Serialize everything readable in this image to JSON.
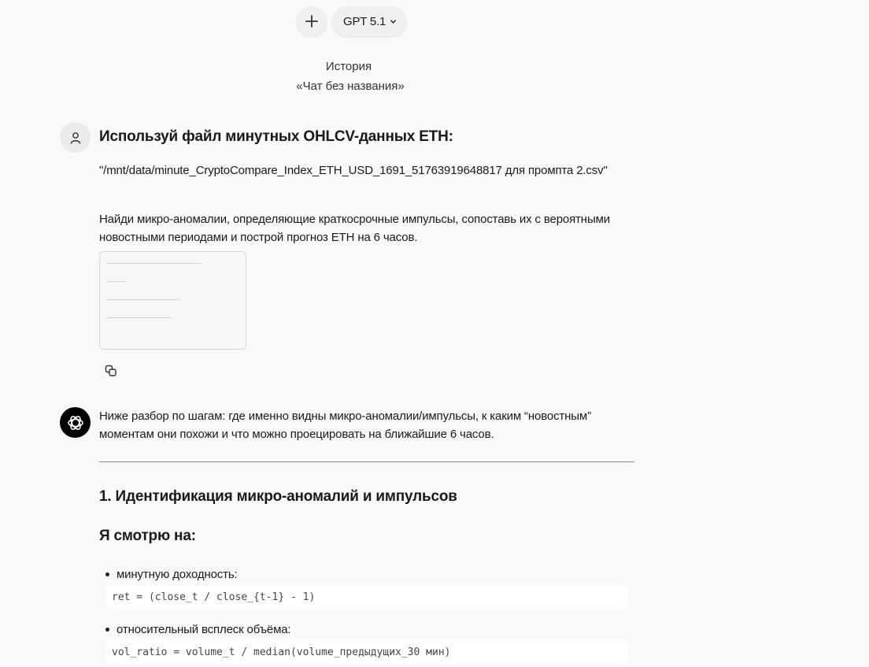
{
  "toolbar": {
    "new_chat_icon": "plus-icon",
    "model_label": "GPT 5.1",
    "model_chevron_icon": "chevron-down-icon"
  },
  "header": {
    "history_label": "История",
    "chat_title": "«Чат без названия»"
  },
  "user_message": {
    "avatar_icon": "user-icon",
    "heading": "Используй файл минутных OHLCV-данных ETH:",
    "path_line": "\"/mnt/data/minute_CryptoCompare_Index_ETH_USD_1691_51763919648817 для промпта 2.csv\"",
    "task": "Найди микро-аномалии, определяющие краткосрочные импульсы, сопоставь их с вероятными новостными периодами и построй прогноз ETH на 6 часов.",
    "attachment_icon": "document-thumbnail",
    "copy_icon": "copy-icon"
  },
  "assistant_message": {
    "avatar_icon": "openai-logo-icon",
    "intro": "Ниже разбор по шагам: где именно видны микро-аномалии/импульсы, к каким “новостным” моментам они похожи и что можно проецировать на ближайшие 6 часов.",
    "section_heading": "1. Идентификация микро-аномалий и импульсов",
    "sub_heading": "Я смотрю на:",
    "items": [
      {
        "label": "минутную доходность:",
        "code": "ret = (close_t / close_{t-1} - 1)"
      },
      {
        "label": "относительный всплеск объёма:",
        "code": "vol_ratio = volume_t / median(volume_предыдущих_30 мин)"
      }
    ]
  }
}
